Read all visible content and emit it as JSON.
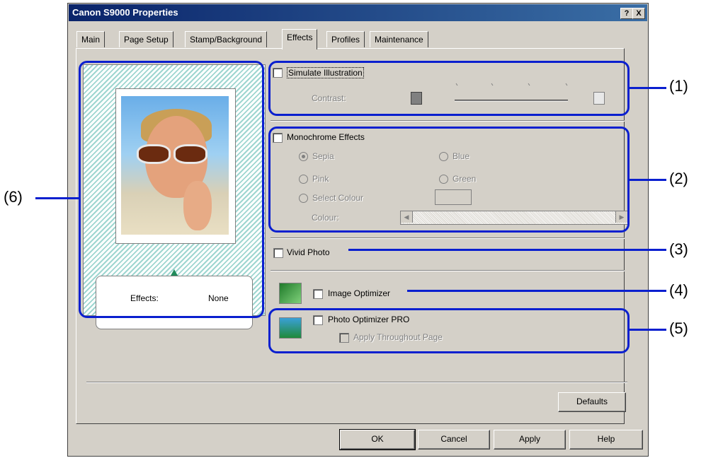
{
  "window": {
    "title": "Canon S9000 Properties",
    "help_btn": "?",
    "close_btn": "X"
  },
  "tabs": [
    "Main",
    "Page Setup",
    "Stamp/Background",
    "Effects",
    "Profiles",
    "Maintenance"
  ],
  "active_tab": "Effects",
  "preview": {
    "effects_label": "Effects:",
    "effects_value": "None"
  },
  "simulate": {
    "label": "Simulate Illustration",
    "checked": false,
    "contrast_label": "Contrast:"
  },
  "monochrome": {
    "label": "Monochrome Effects",
    "checked": false,
    "options": [
      "Sepia",
      "Blue",
      "Pink",
      "Green",
      "Select Colour"
    ],
    "selected": "Sepia",
    "colour_label": "Colour:"
  },
  "vivid": {
    "label": "Vivid Photo",
    "checked": false
  },
  "image_optimizer": {
    "label": "Image Optimizer",
    "checked": false
  },
  "photo_optimizer": {
    "label": "Photo Optimizer PRO",
    "checked": false,
    "apply_label": "Apply Throughout Page"
  },
  "buttons": {
    "defaults": "Defaults",
    "ok": "OK",
    "cancel": "Cancel",
    "apply": "Apply",
    "help": "Help"
  },
  "callouts": [
    "(1)",
    "(2)",
    "(3)",
    "(4)",
    "(5)",
    "(6)"
  ],
  "colors": {
    "callout": "#0a1fcf",
    "titlebar": "#0a246a",
    "dialog": "#d4d0c8"
  }
}
